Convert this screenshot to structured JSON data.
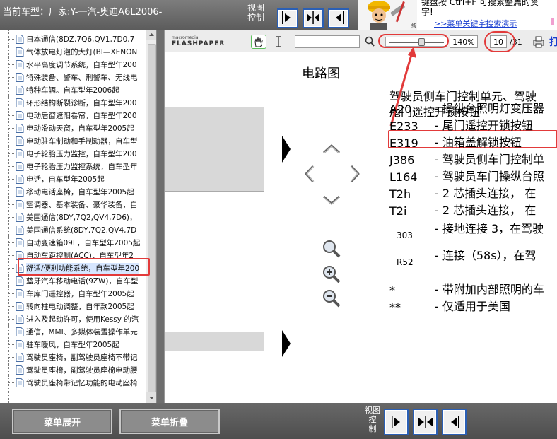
{
  "header": {
    "car_model": "当前车型：厂家:Y-一汽-奥迪A6L2006-",
    "view_control_label_1": "视图",
    "view_control_label_2": "控制",
    "tip_text_line1": "键盘按   Ctrl+F   可搜素整篇的资",
    "tip_text_line2": "字!",
    "tip_link": ">>菜单关键字搜索演示"
  },
  "sidebar": {
    "items": [
      {
        "label": "日本通信(8DZ,7Q6,QV1,7D0,7"
      },
      {
        "label": "气体放电灯泡的大灯(BI—XENON"
      },
      {
        "label": "水平高度调节系统，自车型年200"
      },
      {
        "label": "特殊装备、警车、刑警车、无线电"
      },
      {
        "label": "特种车辆。自车型年2006起"
      },
      {
        "label": "环形结构断裂诊断，自车型年200"
      },
      {
        "label": "电动后窗遮阳卷帘，自车型年200"
      },
      {
        "label": "电动滑动天窗，自车型年2005起"
      },
      {
        "label": "电动驻车制动和手制动器，自车型"
      },
      {
        "label": "电子轮胎压力监控，自车型年200"
      },
      {
        "label": "电子轮胎压力监控系统，自车型年"
      },
      {
        "label": "电话，自车型年2005起"
      },
      {
        "label": "移动电话座椅，自车型年2005起"
      },
      {
        "label": "空调器、基本装备、豪华装备，自"
      },
      {
        "label": "美国通信(8DY,7Q2,QV4,7D6)，"
      },
      {
        "label": "美国通信系统(8DY,7Q2,QV4,7D"
      },
      {
        "label": "自动变速箱09L，自车型年2005起"
      },
      {
        "label": "自动车距控制(ACC)，自车型年2"
      },
      {
        "label": "舒适/便利功能系统，自车型年200"
      },
      {
        "label": "蓝牙汽车移动电话(9ZW)，自车型"
      },
      {
        "label": "车库门遥控器，自车型年2005起"
      },
      {
        "label": "转向柱电动调整，自年款2005起"
      },
      {
        "label": "进入及起动许可，使用Kessy 的汽"
      },
      {
        "label": "通信，MMI、多媒体装置操作单元"
      },
      {
        "label": "驻车暖风，自车型年2005起"
      },
      {
        "label": "驾驶员座椅，副驾驶员座椅不带记"
      },
      {
        "label": "驾驶员座椅，副驾驶员座椅电动腰"
      },
      {
        "label": "驾驶员座椅带记忆功能的电动座椅"
      }
    ],
    "selected_index": 18
  },
  "flashpaper": {
    "logo_top": "macromedia",
    "logo_bottom": "FLASHPAPER",
    "zoom": "140%",
    "page_current": "10",
    "page_total": "/31",
    "print_glyph": "打"
  },
  "document": {
    "heading": "电路图",
    "intro_line1": "驾驶员侧车门控制单元、驾驶",
    "intro_line2": "尾门遥控开锁按钮",
    "entries": [
      {
        "code": "A20",
        "desc": "-  操纵台照明灯变压器"
      },
      {
        "code": "E233",
        "desc": "-  尾门遥控开锁按钮"
      },
      {
        "code": "E319",
        "desc": "-  油箱盖解锁按钮"
      },
      {
        "code": "J386",
        "desc": "-  驾驶员侧车门控制单"
      },
      {
        "code": "L164",
        "desc": "-  驾驶员车门操纵台照"
      },
      {
        "code": "T2h",
        "desc": "-  2 芯插头连接，  在"
      },
      {
        "code": "T2i",
        "desc": "-  2 芯插头连接，  在"
      },
      {
        "code": "303",
        "desc": "-  接地连接 3，在驾驶"
      },
      {
        "code": "R52",
        "desc": "-  连接（58s），在驾"
      },
      {
        "code": "*",
        "desc": "-  带附加内部照明的车"
      },
      {
        "code": "**",
        "desc": "-  仅适用于美国"
      }
    ]
  },
  "footer": {
    "expand_label": "菜单展开",
    "collapse_label": "菜单折叠",
    "view_control_1": "视图",
    "view_control_2": "控",
    "view_control_3": "制"
  },
  "colors": {
    "highlight_box": "#e23a3a",
    "button_border": "#2a5fb5",
    "link": "#1a3fd0"
  }
}
